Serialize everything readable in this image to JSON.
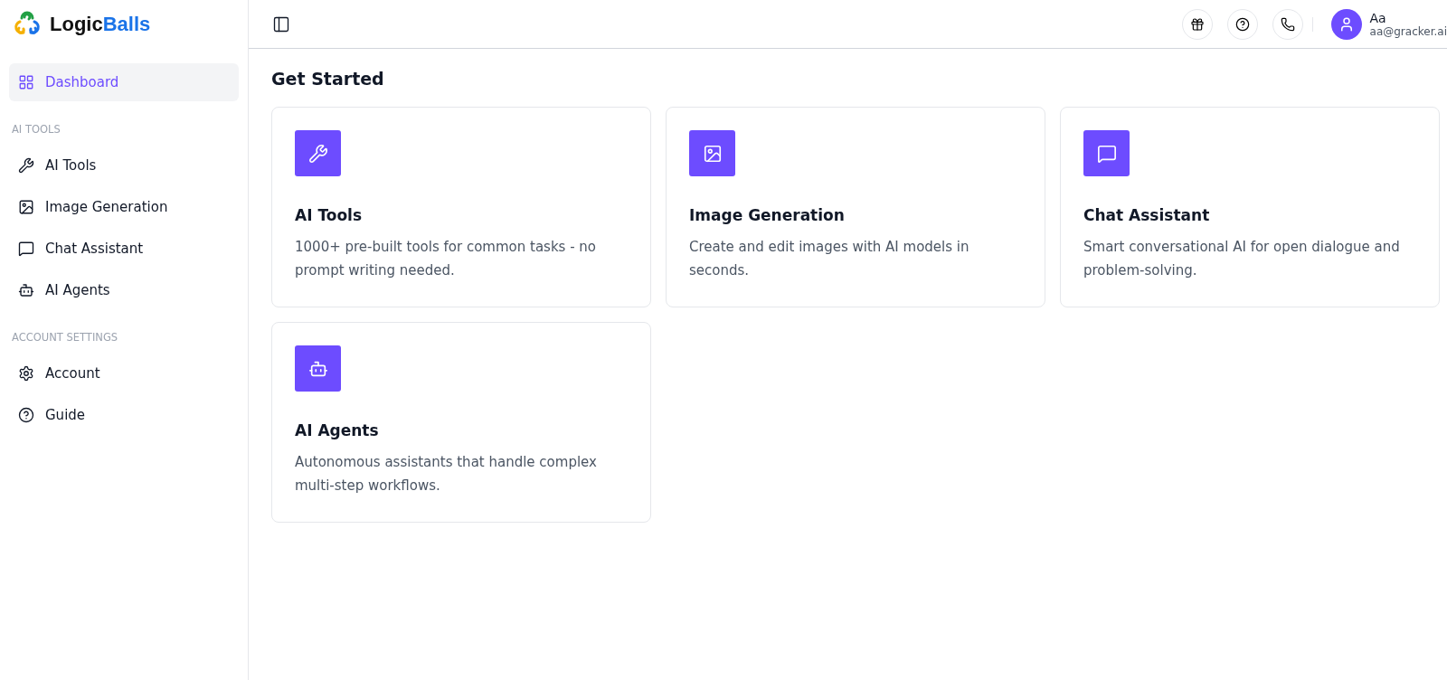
{
  "logo": {
    "part_1": "Logic",
    "part_2": "Balls"
  },
  "sidebar": {
    "items": [
      {
        "kind": "dashboard",
        "label": "Dashboard",
        "selected": true
      }
    ],
    "sections": [
      {
        "title": "AI TOOLS",
        "items": [
          {
            "kind": "tools",
            "label": "AI Tools",
            "selected": false
          },
          {
            "kind": "image",
            "label": "Image Generation",
            "selected": false
          },
          {
            "kind": "chat",
            "label": "Chat Assistant",
            "selected": false
          },
          {
            "kind": "agent",
            "label": "AI Agents",
            "selected": false
          }
        ]
      },
      {
        "title": "ACCOUNT SETTINGS",
        "items": [
          {
            "kind": "settings",
            "label": "Account",
            "selected": false
          },
          {
            "kind": "help",
            "label": "Guide",
            "selected": false
          }
        ]
      }
    ]
  },
  "header": {
    "actions": [
      {
        "kind": "gift"
      },
      {
        "kind": "help"
      },
      {
        "kind": "phone"
      }
    ],
    "user": {
      "name": "Aa",
      "email": "aa@gracker.ai"
    }
  },
  "main": {
    "title": "Get Started",
    "cards": [
      {
        "kind": "tools",
        "title": "AI Tools",
        "description": "1000+ pre-built tools for common tasks - no prompt writing needed."
      },
      {
        "kind": "image",
        "title": "Image Generation",
        "description": "Create and edit images with AI models in seconds."
      },
      {
        "kind": "chat",
        "title": "Chat Assistant",
        "description": "Smart conversational AI for open dialogue and problem-solving."
      },
      {
        "kind": "agent",
        "title": "AI Agents",
        "description": "Autonomous assistants that handle complex multi-step workflows."
      }
    ]
  }
}
